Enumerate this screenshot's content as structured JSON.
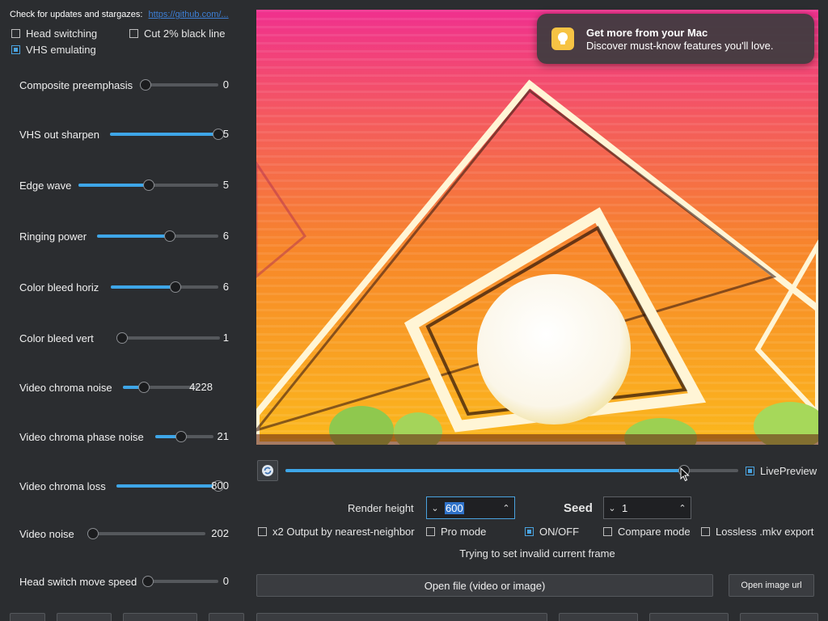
{
  "header": {
    "updates_text": "Check for updates and stargazes:",
    "updates_link": "https://github.com/..."
  },
  "options": {
    "head_switching": {
      "label": "Head switching",
      "checked": false
    },
    "cut_black_line": {
      "label": "Cut 2% black line",
      "checked": false
    },
    "vhs_emulating": {
      "label": "VHS emulating",
      "checked": true
    }
  },
  "sliders": [
    {
      "label": "Composite preemphasis",
      "value": "0",
      "level": 0.0
    },
    {
      "label": "VHS out sharpen",
      "value": "5",
      "level": 1.0
    },
    {
      "label": "Edge wave",
      "value": "5",
      "level": 0.5
    },
    {
      "label": "Ringing power",
      "value": "6",
      "level": 0.6
    },
    {
      "label": "Color bleed horiz",
      "value": "6",
      "level": 0.6
    },
    {
      "label": "Color bleed vert",
      "value": "1",
      "level": 0.05
    },
    {
      "label": "Video chroma noise",
      "value": "4228",
      "level": 0.28
    },
    {
      "label": "Video chroma phase noise",
      "value": "21",
      "level": 0.45
    },
    {
      "label": "Video chroma loss",
      "value": "800",
      "level": 1.0
    },
    {
      "label": "Video noise",
      "value": "202",
      "level": 0.05
    },
    {
      "label": "Head switch move speed",
      "value": "0",
      "level": 0.0
    }
  ],
  "notification": {
    "title": "Get more from your Mac",
    "body": "Discover must-know features you'll love."
  },
  "frame": {
    "position": 0.88,
    "live_preview_label": "LivePreview",
    "live_preview_checked": true
  },
  "render": {
    "height_label": "Render height",
    "height_value": "600",
    "seed_label": "Seed",
    "seed_value": "1"
  },
  "toggles": {
    "x2_output": {
      "label": "x2 Output by nearest-neighbor",
      "checked": false
    },
    "pro_mode": {
      "label": "Pro mode",
      "checked": false
    },
    "on_off": {
      "label": "ON/OFF",
      "checked": true
    },
    "compare_mode": {
      "label": "Compare mode",
      "checked": false
    },
    "lossless": {
      "label": "Lossless .mkv export",
      "checked": false
    }
  },
  "status_text": "Trying to set invalid current frame",
  "buttons": {
    "open_file": "Open file (video or image)",
    "open_image_url": "Open image url"
  },
  "colors": {
    "accent": "#3ea6e8",
    "background": "#2b2d30"
  }
}
